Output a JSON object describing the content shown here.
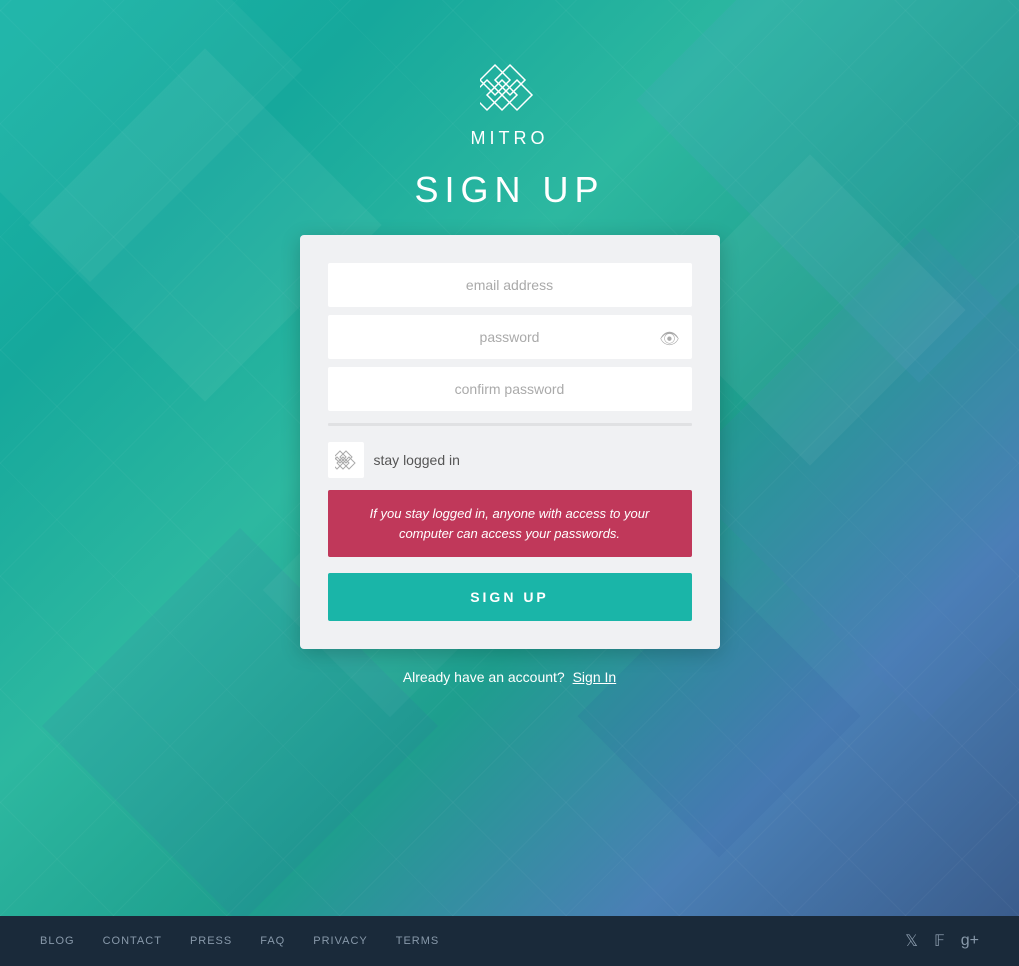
{
  "logo": {
    "text": "MITRO"
  },
  "page": {
    "title": "SIGN UP"
  },
  "form": {
    "email_placeholder": "email address",
    "password_placeholder": "password",
    "confirm_password_placeholder": "confirm password",
    "stay_logged_label": "stay logged in",
    "warning_text": "If you stay logged in, anyone with access to your computer can access your passwords.",
    "signup_button": "SIGN UP"
  },
  "footer": {
    "already_text": "Already have an account?",
    "signin_text": "Sign In",
    "links": [
      "BLOG",
      "CONTACT",
      "PRESS",
      "FAQ",
      "PRIVACY",
      "TERMS"
    ]
  }
}
